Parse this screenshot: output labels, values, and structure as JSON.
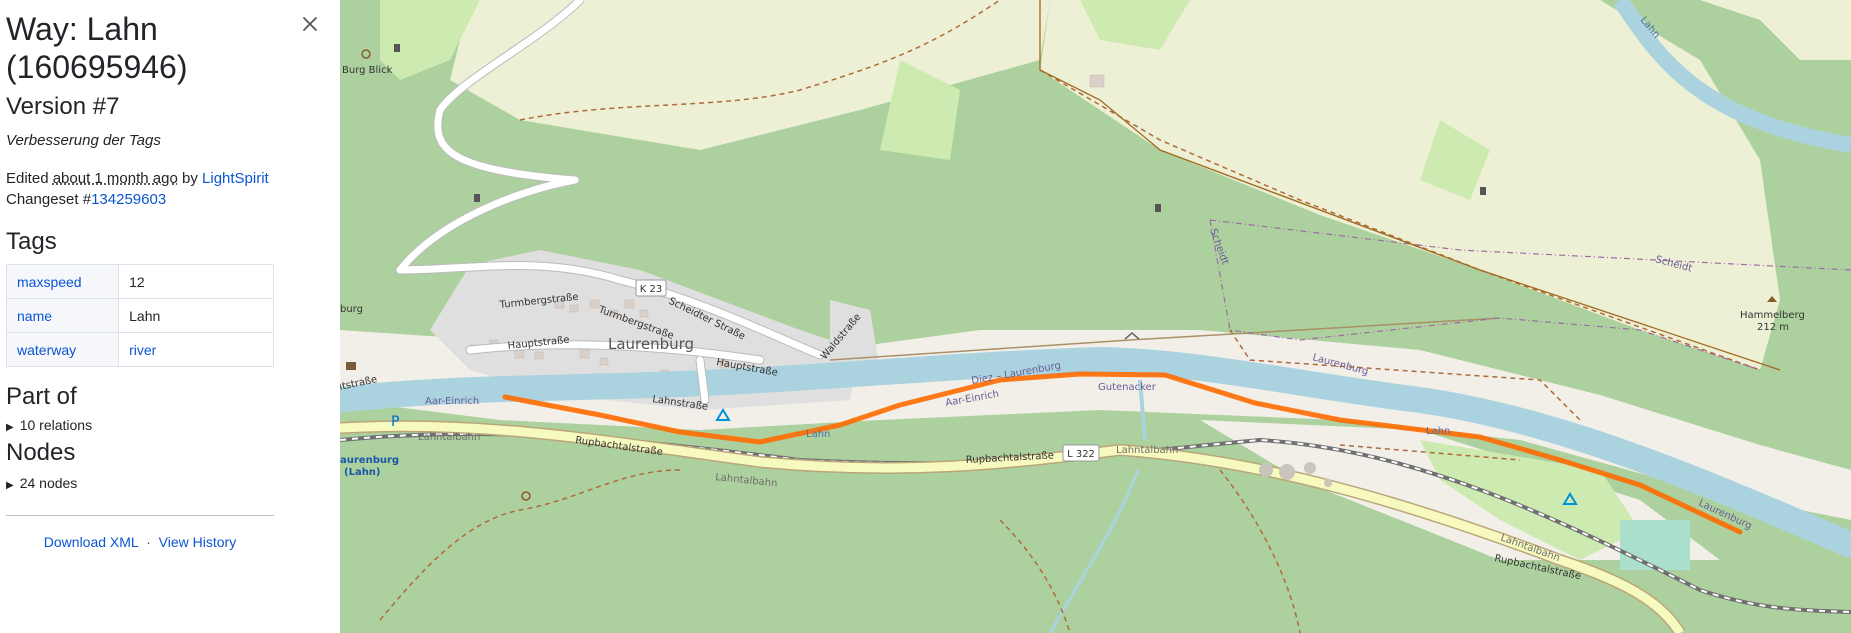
{
  "sidebar": {
    "title": "Way: Lahn (160695946)",
    "version": "Version #7",
    "comment": "Verbesserung der Tags",
    "edited_prefix": "Edited",
    "edited_time": "about 1 month ago",
    "edited_by_word": "by",
    "author": "LightSpirit",
    "changeset_prefix": "Changeset #",
    "changeset_id": "134259603",
    "tags_heading": "Tags",
    "tags": [
      {
        "key": "maxspeed",
        "value": "12"
      },
      {
        "key": "name",
        "value": "Lahn"
      },
      {
        "key": "waterway",
        "value": "river"
      }
    ],
    "part_of_heading": "Part of",
    "relations_summary": "10 relations",
    "nodes_heading": "Nodes",
    "nodes_summary": "24 nodes",
    "download_xml": "Download XML",
    "link_separator": "·",
    "view_history": "View History"
  },
  "map": {
    "labels": {
      "burg_blick": "Burg Blick",
      "laurenburg_town": "Laurenburg",
      "k23": "K 23",
      "l322": "L 322",
      "turmbergstrasse": "Turmbergstraße",
      "turmbergstrasse2": "Turmbergstraße",
      "scheidter": "Scheidter Straße",
      "hauptstrasse1": "Hauptstraße",
      "hauptstrasse2": "Hauptstraße",
      "waldstrasse": "Waldstraße",
      "lahnstrasse": "Lahnstraße",
      "aar_einrich1": "Aar-Einrich",
      "aar_einrich2": "Aar-Einrich",
      "diez_laurenburg": "Diez – Laurenburg",
      "gutenacker": "Gutenacker",
      "laurenburg_dist": "Laurenburg",
      "laurenburg_dist2": "Laurenburg",
      "lahntalbahn1": "Lahntalbahn",
      "lahntalbahn2": "Lahntalbahn",
      "lahntalbahn3": "Lahntalbahn",
      "lahntalbahn4": "Lahntalbahn",
      "rupbachtal1": "Rupbachtalstraße",
      "rupbachtal2": "Rupbachtalstraße",
      "rupbachtal3": "Rupbachtalstraße",
      "lahn_river1": "Lahn",
      "lahn_river2": "Lahn",
      "lahn_top": "Lahn",
      "scheidt1": "Scheidt",
      "scheidt2": "Scheidt",
      "hammelberg": "Hammelberg",
      "hammelberg_ele": "212 m",
      "burg_edge": "burg",
      "strasse_edge": "ıtstraße",
      "station_line1": "aurenburg",
      "station_line2": "(Lahn)",
      "parking": "P"
    },
    "colors": {
      "forest": "#add19e",
      "farmland": "#eef0d5",
      "meadow": "#cdebb0",
      "water": "#aad3df",
      "residential": "#e0dfdf",
      "road_yellow": "#f7fabf",
      "highlight": "#ff6a00",
      "boundary": "#b06a3a"
    }
  }
}
